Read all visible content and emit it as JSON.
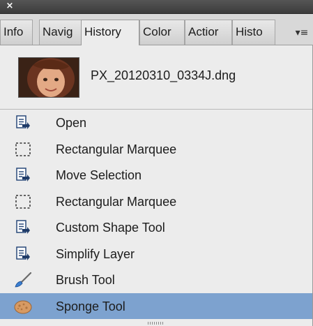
{
  "titlebar": {
    "close_glyph": "×"
  },
  "tabs": [
    {
      "label": "Info",
      "active": false
    },
    {
      "label": "Navig",
      "active": false
    },
    {
      "label": "History",
      "active": true
    },
    {
      "label": "Color",
      "active": false
    },
    {
      "label": "Actior",
      "active": false
    },
    {
      "label": "Histo",
      "active": false
    }
  ],
  "panel_menu_glyph": "▾≡",
  "snapshot": {
    "name": "PX_20120310_0334J.dng"
  },
  "history": [
    {
      "label": "Open",
      "icon": "history-step-icon",
      "selected": false
    },
    {
      "label": "Rectangular Marquee",
      "icon": "rectangular-marquee-icon",
      "selected": false
    },
    {
      "label": "Move Selection",
      "icon": "history-step-icon",
      "selected": false
    },
    {
      "label": "Rectangular Marquee",
      "icon": "rectangular-marquee-icon",
      "selected": false
    },
    {
      "label": "Custom Shape Tool",
      "icon": "history-step-icon",
      "selected": false
    },
    {
      "label": "Simplify Layer",
      "icon": "history-step-icon",
      "selected": false
    },
    {
      "label": "Brush Tool",
      "icon": "brush-icon",
      "selected": false
    },
    {
      "label": "Sponge Tool",
      "icon": "sponge-icon",
      "selected": true
    }
  ],
  "colors": {
    "selection": "#7da2cf",
    "titlebar": "#3c3c3c",
    "panel_bg": "#ececec"
  }
}
